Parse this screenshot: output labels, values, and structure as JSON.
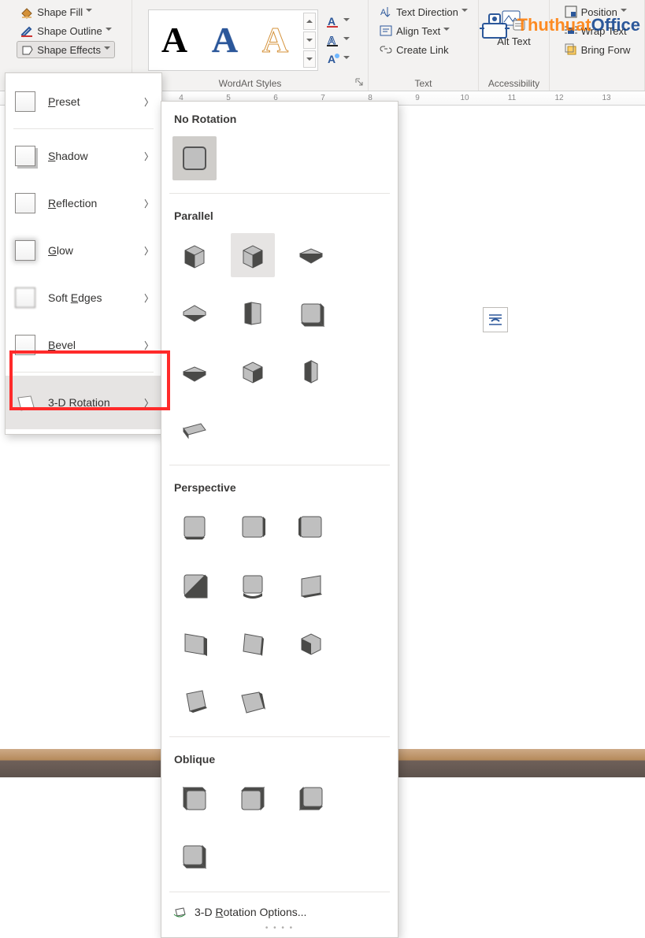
{
  "watermark": {
    "brandA": "Thuthuat",
    "brandB": "Office"
  },
  "ribbon": {
    "shape_styles": {
      "fill": "Shape Fill",
      "outline": "Shape Outline",
      "effects": "Shape Effects"
    },
    "wordart": {
      "label": "WordArt Styles",
      "sample_glyph": "A"
    },
    "text": {
      "direction": "Text Direction",
      "align": "Align Text",
      "link": "Create Link",
      "label": "Text"
    },
    "accessibility": {
      "btn": "Alt Text",
      "label": "Accessibility"
    },
    "arrange": {
      "position": "Position",
      "wrap": "Wrap Text",
      "bring_forward": "Bring Forw"
    }
  },
  "ruler": [
    "4",
    "5",
    "6",
    "7",
    "8",
    "9",
    "10",
    "11",
    "12",
    "13"
  ],
  "effects_menu": {
    "items": [
      {
        "label": "Preset",
        "u": 0
      },
      {
        "label": "Shadow",
        "u": 0
      },
      {
        "label": "Reflection",
        "u": 0
      },
      {
        "label": "Glow",
        "u": 0
      },
      {
        "label": "Soft Edges",
        "u": 5
      },
      {
        "label": "Bevel",
        "u": 0
      },
      {
        "label": "3-D Rotation",
        "u": 2
      }
    ]
  },
  "rotation": {
    "no_rotation": "No Rotation",
    "parallel": "Parallel",
    "perspective": "Perspective",
    "oblique": "Oblique",
    "more": "3-D Rotation Options..."
  }
}
